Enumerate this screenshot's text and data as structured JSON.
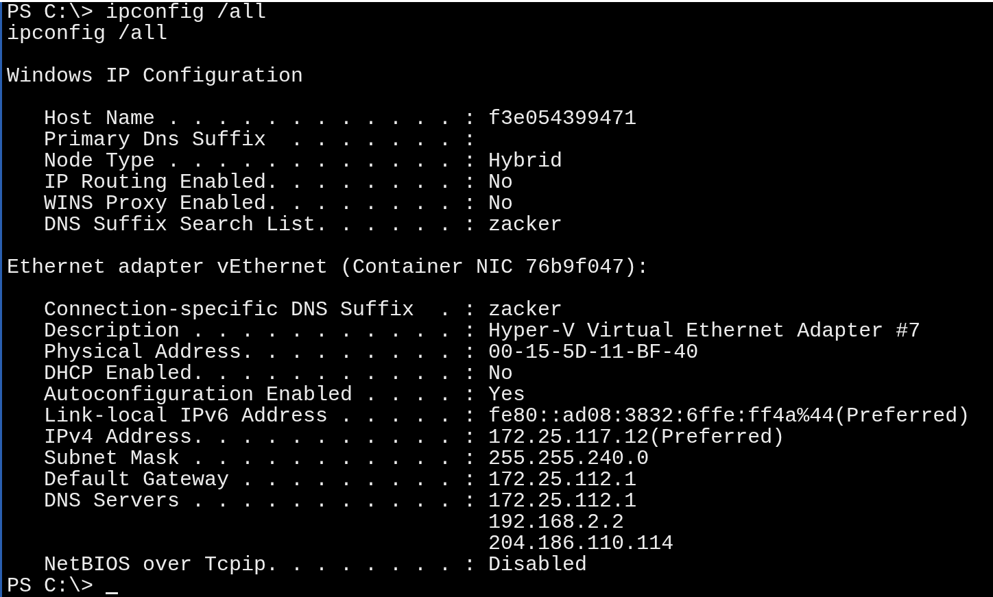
{
  "console": {
    "lines": [
      {
        "kind": "command",
        "prompt": "PS C:\\>",
        "text": "ipconfig /all"
      },
      {
        "kind": "echo",
        "text": "ipconfig /all"
      },
      {
        "kind": "blank"
      },
      {
        "kind": "heading",
        "text": "Windows IP Configuration"
      },
      {
        "kind": "blank"
      },
      {
        "kind": "field",
        "label": "Host Name . . . . . . . . . . . . :",
        "values": [
          "f3e054399471"
        ]
      },
      {
        "kind": "field",
        "label": "Primary Dns Suffix  . . . . . . . :"
      },
      {
        "kind": "field",
        "label": "Node Type . . . . . . . . . . . . :",
        "values": [
          "Hybrid"
        ]
      },
      {
        "kind": "field",
        "label": "IP Routing Enabled. . . . . . . . :",
        "values": [
          "No"
        ]
      },
      {
        "kind": "field",
        "label": "WINS Proxy Enabled. . . . . . . . :",
        "values": [
          "No"
        ]
      },
      {
        "kind": "field",
        "label": "DNS Suffix Search List. . . . . . :",
        "values": [
          "zacker"
        ]
      },
      {
        "kind": "blank"
      },
      {
        "kind": "heading",
        "text": "Ethernet adapter vEthernet (Container NIC 76b9f047):"
      },
      {
        "kind": "blank"
      },
      {
        "kind": "field",
        "label": "Connection-specific DNS Suffix  . :",
        "values": [
          "zacker"
        ]
      },
      {
        "kind": "field",
        "label": "Description . . . . . . . . . . . :",
        "values": [
          "Hyper-V Virtual Ethernet Adapter #7"
        ]
      },
      {
        "kind": "field",
        "label": "Physical Address. . . . . . . . . :",
        "values": [
          "00-15-5D-11-BF-40"
        ]
      },
      {
        "kind": "field",
        "label": "DHCP Enabled. . . . . . . . . . . :",
        "values": [
          "No"
        ]
      },
      {
        "kind": "field",
        "label": "Autoconfiguration Enabled . . . . :",
        "values": [
          "Yes"
        ]
      },
      {
        "kind": "field",
        "label": "Link-local IPv6 Address . . . . . :",
        "values": [
          "fe80::ad08:3832:6ffe:ff4a%44(Preferred)"
        ]
      },
      {
        "kind": "field",
        "label": "IPv4 Address. . . . . . . . . . . :",
        "values": [
          "172.25.117.12(Preferred)"
        ]
      },
      {
        "kind": "field",
        "label": "Subnet Mask . . . . . . . . . . . :",
        "values": [
          "255.255.240.0"
        ]
      },
      {
        "kind": "field",
        "label": "Default Gateway . . . . . . . . . :",
        "values": [
          "172.25.112.1"
        ]
      },
      {
        "kind": "field",
        "label": "DNS Servers . . . . . . . . . . . :",
        "values": [
          "172.25.112.1",
          "192.168.2.2",
          "204.186.110.114"
        ]
      },
      {
        "kind": "field",
        "label": "NetBIOS over Tcpip. . . . . . . . :",
        "values": [
          "Disabled"
        ]
      },
      {
        "kind": "prompt",
        "prompt": "PS C:\\>",
        "cursor": true
      }
    ]
  }
}
